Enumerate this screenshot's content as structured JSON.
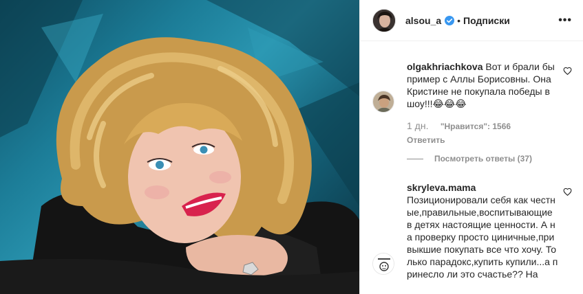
{
  "post": {
    "author": "alsou_a",
    "separator": "•",
    "follow_label": "Подписки",
    "more_label": "•••",
    "verified_color": "#3897f0"
  },
  "comments": [
    {
      "user": "olgakhriachkova",
      "text": "Вот и брали бы пример с Аллы Борисовны. Она Кристине не покупала победы в шоу!!!😂😂😂",
      "ago": "1 дн.",
      "likes": "\"Нравится\": 1566",
      "reply_label": "Ответить",
      "view_replies": "Посмотреть ответы (37)"
    },
    {
      "user": "skryleva.mama",
      "text": "Позиционировали себя как честные,правильные,воспитывающие в детях настоящие ценности. А на проверку просто циничные,привыкшие покупать все что хочу. Только парадокс,купить купили...а принесло ли это счастье?? На"
    }
  ]
}
